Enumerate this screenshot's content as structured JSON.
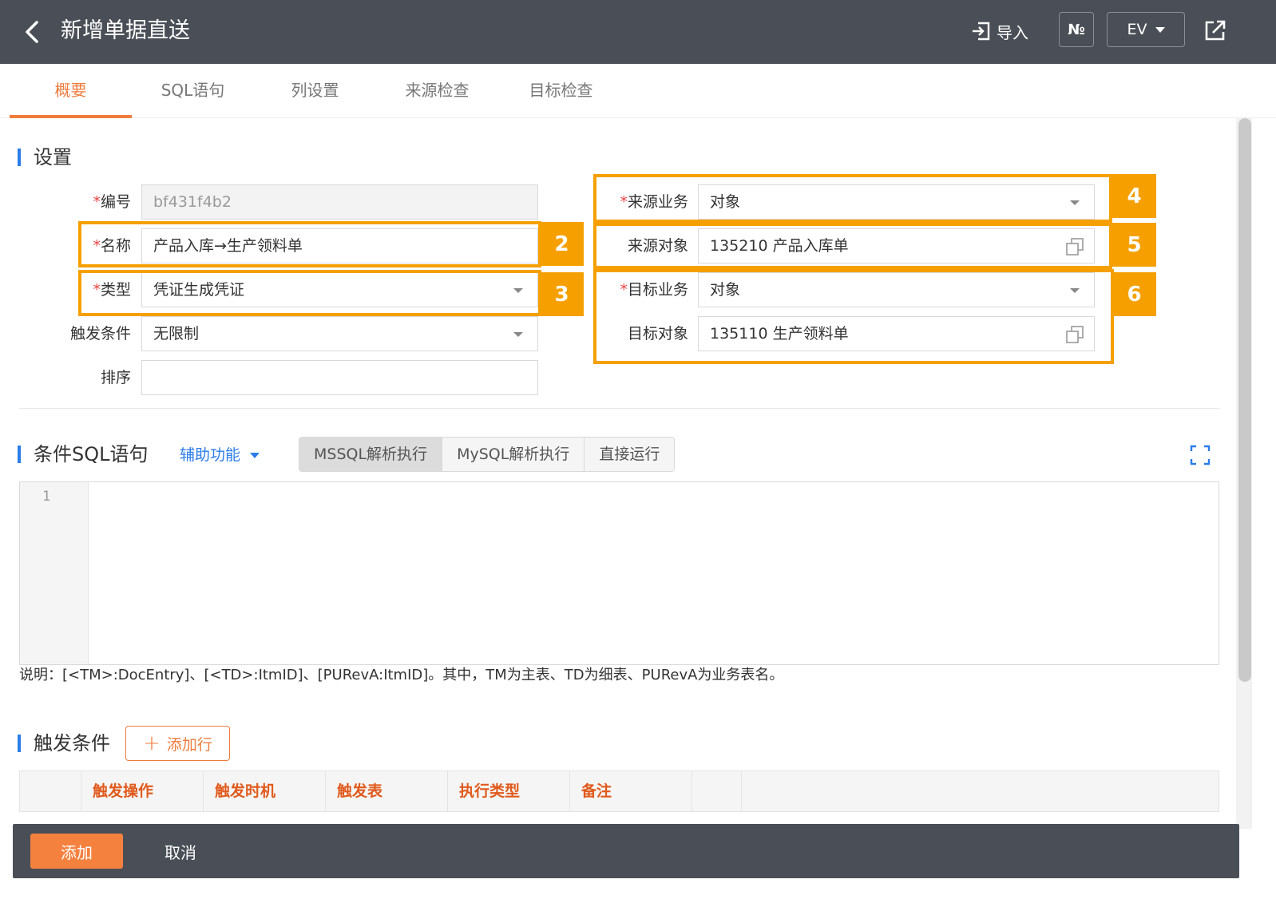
{
  "header": {
    "title": "新增单据直送",
    "import_label": "导入",
    "no_label": "№",
    "lang_label": "EV"
  },
  "tabs": [
    {
      "label": "概要",
      "active": true
    },
    {
      "label": "SQL语句",
      "active": false
    },
    {
      "label": "列设置",
      "active": false
    },
    {
      "label": "来源检查",
      "active": false
    },
    {
      "label": "目标检查",
      "active": false
    }
  ],
  "settings": {
    "section_title": "设置",
    "code": {
      "label": "编号",
      "required": "*",
      "value": "bf431f4b2"
    },
    "name": {
      "label": "名称",
      "required": "*",
      "value": "产品入库→生产领料单"
    },
    "type": {
      "label": "类型",
      "required": "*",
      "value": "凭证生成凭证"
    },
    "trigger": {
      "label": "触发条件",
      "value": "无限制"
    },
    "sort": {
      "label": "排序",
      "value": ""
    },
    "source_business": {
      "label": "来源业务",
      "required": "*",
      "value": "对象"
    },
    "source_object": {
      "label": "来源对象",
      "value": "135210 产品入库单"
    },
    "target_business": {
      "label": "目标业务",
      "required": "*",
      "value": "对象"
    },
    "target_object": {
      "label": "目标对象",
      "value": "135110 生产领料单"
    }
  },
  "badges": {
    "b2": "2",
    "b3": "3",
    "b4": "4",
    "b5": "5",
    "b6": "6"
  },
  "sql": {
    "section_title": "条件SQL语句",
    "assist_label": "辅助功能",
    "buttons": [
      "MSSQL解析执行",
      "MySQL解析执行",
      "直接运行"
    ],
    "line_number": "1",
    "note": "说明：[<TM>:DocEntry]、[<TD>:ItmID]、[PURevA:ItmID]。其中，TM为主表、TD为细表、PURevA为业务表名。"
  },
  "trigger_section": {
    "title": "触发条件",
    "add_row_label": "添加行",
    "columns": [
      "触发操作",
      "触发时机",
      "触发表",
      "执行类型",
      "备注"
    ]
  },
  "footer": {
    "add_label": "添加",
    "cancel_label": "取消"
  },
  "colors": {
    "header_bg": "#4a4f57",
    "accent_orange": "#f07c3c",
    "highlight": "#f5a000",
    "section_blue": "#2b7de9",
    "required_red": "#e64545"
  }
}
